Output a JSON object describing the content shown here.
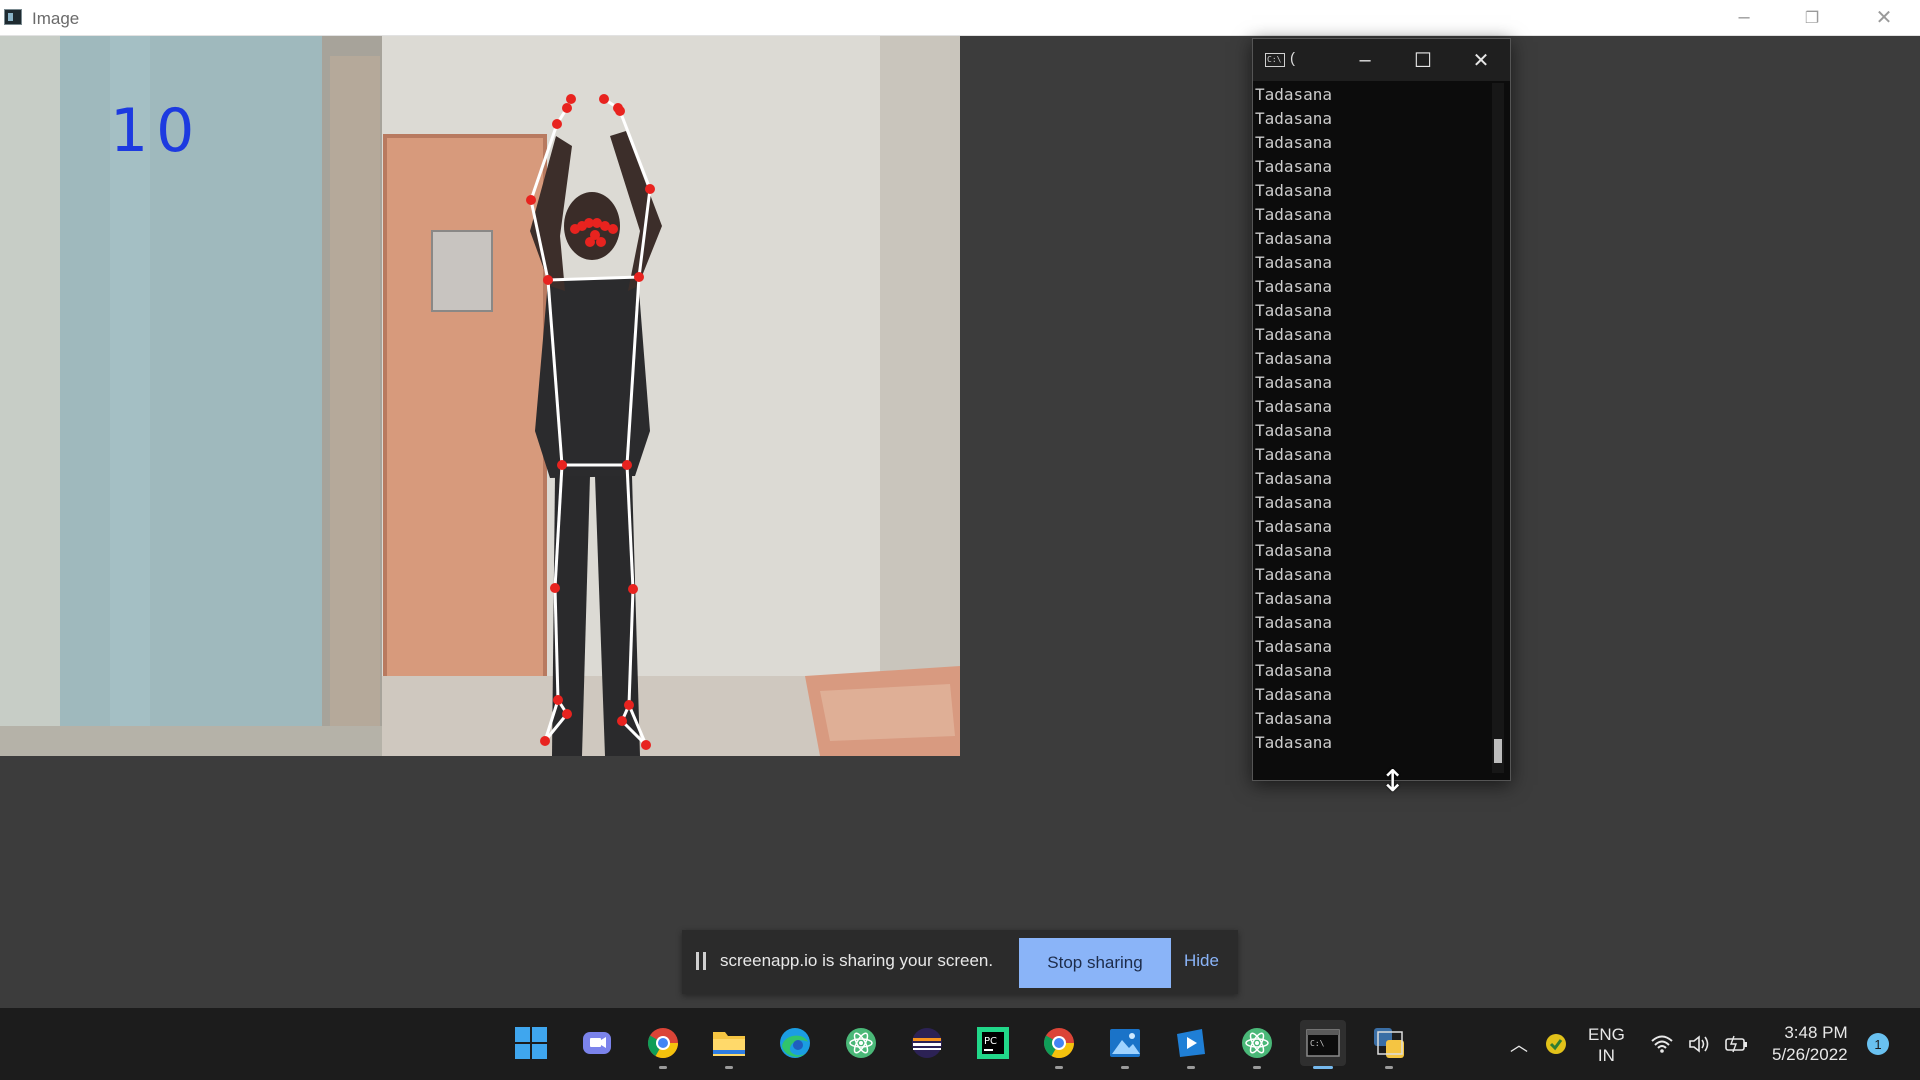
{
  "window": {
    "title": "Image",
    "controls": {
      "minimize": "–",
      "restore": "❐",
      "close": "✕"
    }
  },
  "camera": {
    "counter": "10",
    "colors": {
      "skeleton": "#ffffff",
      "landmark": "#e8231f",
      "counter": "#1d3ae0"
    }
  },
  "console": {
    "title": "(",
    "controls": {
      "minimize": "–",
      "maximize": "☐",
      "close": "✕"
    },
    "lines": [
      "Tadasana",
      "Tadasana",
      "Tadasana",
      "Tadasana",
      "Tadasana",
      "Tadasana",
      "Tadasana",
      "Tadasana",
      "Tadasana",
      "Tadasana",
      "Tadasana",
      "Tadasana",
      "Tadasana",
      "Tadasana",
      "Tadasana",
      "Tadasana",
      "Tadasana",
      "Tadasana",
      "Tadasana",
      "Tadasana",
      "Tadasana",
      "Tadasana",
      "Tadasana",
      "Tadasana",
      "Tadasana",
      "Tadasana",
      "Tadasana",
      "Tadasana"
    ]
  },
  "share_bar": {
    "message": "screenapp.io is sharing your screen.",
    "stop_label": "Stop sharing",
    "hide_label": "Hide"
  },
  "taskbar": {
    "apps": [
      {
        "name": "start-icon"
      },
      {
        "name": "teams-chat-icon"
      },
      {
        "name": "chrome-icon"
      },
      {
        "name": "file-explorer-icon"
      },
      {
        "name": "edge-icon"
      },
      {
        "name": "atom-icon"
      },
      {
        "name": "eclipse-icon"
      },
      {
        "name": "pycharm-icon"
      },
      {
        "name": "chrome-profile-icon"
      },
      {
        "name": "photos-icon"
      },
      {
        "name": "media-player-icon"
      },
      {
        "name": "atom-2-icon"
      },
      {
        "name": "terminal-icon"
      },
      {
        "name": "python-icon"
      }
    ],
    "tray": {
      "language": "ENG",
      "region": "IN",
      "time": "3:48 PM",
      "date": "5/26/2022",
      "notification_count": "1"
    }
  }
}
